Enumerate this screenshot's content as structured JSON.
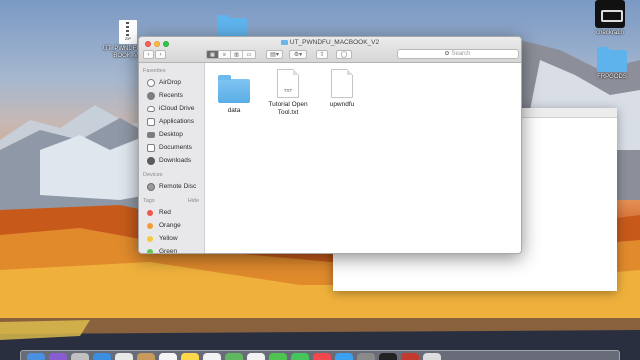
{
  "desktop": {
    "zip_file": {
      "tag": "ZIP",
      "line1": "UT_PWNDFU_MA",
      "line2": "BOOK_V..."
    },
    "checkra1n": {
      "label": "checkra1n"
    },
    "frpgods": {
      "label": "FRPGODS"
    }
  },
  "finder": {
    "title": "UT_PWNDFU_MACBOOK_V2",
    "search_placeholder": "Search",
    "sidebar": {
      "favorites_header": "Favorites",
      "favorites": [
        {
          "label": "AirDrop",
          "icon": "airdrop-icon"
        },
        {
          "label": "Recents",
          "icon": "recents-icon"
        },
        {
          "label": "iCloud Drive",
          "icon": "icloud-icon"
        },
        {
          "label": "Applications",
          "icon": "applications-icon"
        },
        {
          "label": "Desktop",
          "icon": "desktop-icon"
        },
        {
          "label": "Documents",
          "icon": "documents-icon"
        },
        {
          "label": "Downloads",
          "icon": "downloads-icon"
        }
      ],
      "devices_header": "Devices",
      "devices": [
        {
          "label": "Remote Disc",
          "icon": "remote-disc-icon"
        }
      ],
      "tags_header": "Tags",
      "tags_hide": "Hide",
      "tags": [
        {
          "label": "Red",
          "color": "#f2554c"
        },
        {
          "label": "Orange",
          "color": "#f79a36"
        },
        {
          "label": "Yellow",
          "color": "#f5c93b"
        },
        {
          "label": "Green",
          "color": "#5cc84c"
        }
      ]
    },
    "files": [
      {
        "name": "data",
        "kind": "folder"
      },
      {
        "name": "Tutorial Open Tool.txt",
        "kind": "txt",
        "tag": "TXT"
      },
      {
        "name": "upwndfu",
        "kind": "document"
      }
    ]
  },
  "colors": {
    "finder_toolbar": "#dcdcdc",
    "sidebar_bg": "#e8e8ea",
    "folder_blue": "#5aaee6"
  }
}
